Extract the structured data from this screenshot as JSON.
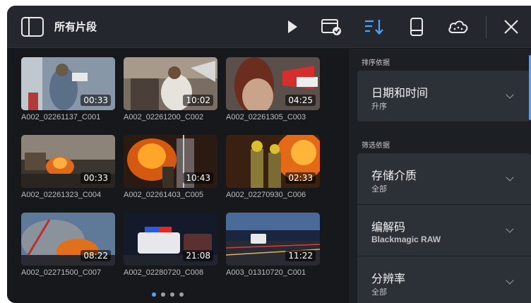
{
  "header": {
    "title": "所有片段"
  },
  "clips": [
    {
      "name": "A002_02261137_C001",
      "duration": "00:33"
    },
    {
      "name": "A002_02261200_C002",
      "duration": "10:02"
    },
    {
      "name": "A002_02261305_C003",
      "duration": "04:25"
    },
    {
      "name": "A002_02261323_C004",
      "duration": "00:33"
    },
    {
      "name": "A002_02261403_C005",
      "duration": "10:43"
    },
    {
      "name": "A002_02270930_C006",
      "duration": "02:33"
    },
    {
      "name": "A002_02271500_C007",
      "duration": "08:22"
    },
    {
      "name": "A002_02280720_C008",
      "duration": "21:08"
    },
    {
      "name": "A003_01310720_C001",
      "duration": "11:22"
    }
  ],
  "side": {
    "sort_label": "排序依据",
    "sort_title": "日期和时间",
    "sort_value": "升序",
    "filter_label": "筛选依据",
    "filters": [
      {
        "title": "存储介质",
        "value": "全部"
      },
      {
        "title": "编解码",
        "value": "Blackmagic RAW"
      },
      {
        "title": "分辨率",
        "value": "全部"
      }
    ]
  },
  "colors": {
    "accent": "#4da3ff",
    "header_bg": "#24272d",
    "card_bg": "#2c3037"
  }
}
